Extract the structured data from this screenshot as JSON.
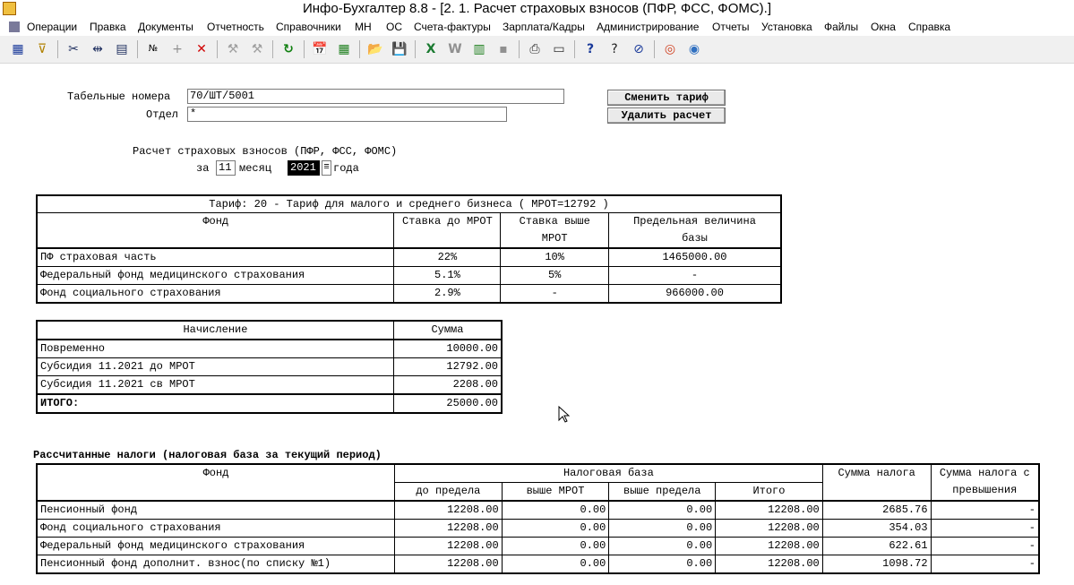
{
  "window": {
    "title": "Инфо-Бухгалтер 8.8 - [2. 1. Расчет страховых взносов (ПФР, ФСС, ФОМС).]"
  },
  "menu": [
    "Операции",
    "Правка",
    "Документы",
    "Отчетность",
    "Справочники",
    "МН",
    "ОС",
    "Счета-фактуры",
    "Зарплата/Кадры",
    "Администрирование",
    "Отчеты",
    "Установка",
    "Файлы",
    "Окна",
    "Справка"
  ],
  "toolbar": {
    "icons": [
      "table-icon",
      "filter-icon",
      "cut-icon",
      "paste-icon",
      "copy-icon",
      "number-icon",
      "plus-icon",
      "delete-icon",
      "tool-icon",
      "tool2-icon",
      "refresh-icon",
      "calendar-icon",
      "calculator-icon",
      "open-folder-icon",
      "save-icon",
      "excel-icon",
      "word-icon",
      "export-icon",
      "gray-icon",
      "print-icon",
      "preview-icon",
      "help-icon",
      "context-help-icon",
      "compass-icon",
      "lifebuoy-icon",
      "web-icon"
    ],
    "glyphs": [
      "▦",
      "⊽",
      "✂",
      "⇹",
      "▤",
      "№",
      "+",
      "✕",
      "⚒",
      "⚒",
      "↻",
      "📅",
      "▦",
      "📂",
      "💾",
      "X",
      "W",
      "▥",
      "▪",
      "⎙",
      "▭",
      "?",
      "?",
      "⊘",
      "◎",
      "◉"
    ]
  },
  "form": {
    "tabel_label": "Табельные номера",
    "tabel_value": "70/ШТ/5001",
    "otdel_label": "Отдел",
    "otdel_value": "*",
    "btn_change_tariff": "Сменить тариф",
    "btn_delete_calc": "Удалить расчет",
    "calc_title": "Расчет страховых взносов (ПФР, ФСС, ФОМС)",
    "za_label": "за",
    "month_value": "11",
    "month_label": "месяц",
    "year_value": "2021",
    "year_label": "года"
  },
  "tariff_table": {
    "title": "Тариф: 20 - Тариф для малого и среднего бизнеса ( МРОТ=12792 )",
    "headers": [
      "Фонд",
      "Ставка до МРОТ",
      "Ставка выше",
      "МРОТ",
      "Предельная величина",
      "базы"
    ],
    "rows": [
      [
        "ПФ страховая часть",
        "22%",
        "10%",
        "1465000.00"
      ],
      [
        "Федеральный фонд медицинского страхования",
        "5.1%",
        "5%",
        "-"
      ],
      [
        "Фонд социального страхования",
        "2.9%",
        "-",
        "966000.00"
      ]
    ]
  },
  "accrual_table": {
    "headers": [
      "Начисление",
      "Сумма"
    ],
    "rows": [
      [
        "Повременно",
        "10000.00"
      ],
      [
        "Субсидия 11.2021 до МРОТ",
        "12792.00"
      ],
      [
        "Субсидия 11.2021 св МРОТ",
        "2208.00"
      ]
    ],
    "total": [
      "ИТОГО:",
      "25000.00"
    ]
  },
  "taxes": {
    "caption": "Рассчитанные налоги (налоговая база за текущий период)",
    "headers": {
      "fond": "Фонд",
      "base": "Налоговая база",
      "sum_tax": "Сумма налога",
      "sum_excess_1": "Сумма налога с",
      "sum_excess_2": "превышения",
      "below": "до предела",
      "above_mrot": "выше МРОТ",
      "above_limit": "выше предела",
      "total": "Итого"
    },
    "rows": [
      [
        "Пенсионный фонд",
        "12208.00",
        "0.00",
        "0.00",
        "12208.00",
        "2685.76",
        "-"
      ],
      [
        "Фонд социального страхования",
        "12208.00",
        "0.00",
        "0.00",
        "12208.00",
        "354.03",
        "-"
      ],
      [
        "Федеральный фонд медицинского страхования",
        "12208.00",
        "0.00",
        "0.00",
        "12208.00",
        "622.61",
        "-"
      ],
      [
        "Пенсионный фонд дополнит. взнос(по списку №1)",
        "12208.00",
        "0.00",
        "0.00",
        "12208.00",
        "1098.72",
        "-"
      ]
    ]
  }
}
